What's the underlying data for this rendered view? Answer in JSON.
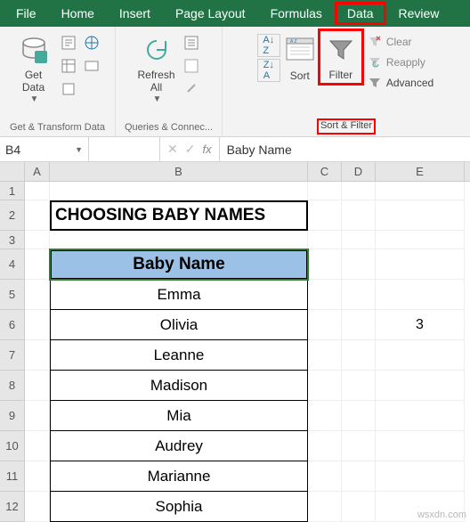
{
  "menubar": {
    "items": [
      "File",
      "Home",
      "Insert",
      "Page Layout",
      "Formulas",
      "Data",
      "Review"
    ],
    "highlighted": "Data"
  },
  "ribbon": {
    "getTransform": {
      "getData": "Get\nData",
      "label": "Get & Transform Data"
    },
    "queries": {
      "refreshAll": "Refresh\nAll",
      "label": "Queries & Connec..."
    },
    "sortFilter": {
      "sort": "Sort",
      "filter": "Filter",
      "clear": "Clear",
      "reapply": "Reapply",
      "advanced": "Advanced",
      "label": "Sort & Filter"
    }
  },
  "namebox": {
    "ref": "B4"
  },
  "formulabar": {
    "value": "Baby Name"
  },
  "columns": {
    "A": "A",
    "B": "B",
    "C": "C",
    "D": "D",
    "E": "E"
  },
  "rows": {
    "r1": "1",
    "r2": "2",
    "r3": "3",
    "r4": "4",
    "r5": "5",
    "r6": "6",
    "r7": "7",
    "r8": "8",
    "r9": "9",
    "r10": "10",
    "r11": "11",
    "r12": "12"
  },
  "sheet": {
    "title": "CHOOSING BABY NAMES",
    "header": "Baby Name",
    "names": [
      "Emma",
      "Olivia",
      "Leanne",
      "Madison",
      "Mia",
      "Audrey",
      "Marianne",
      "Sophia"
    ],
    "sideValue": "3"
  },
  "watermark": "wsxdn.com"
}
